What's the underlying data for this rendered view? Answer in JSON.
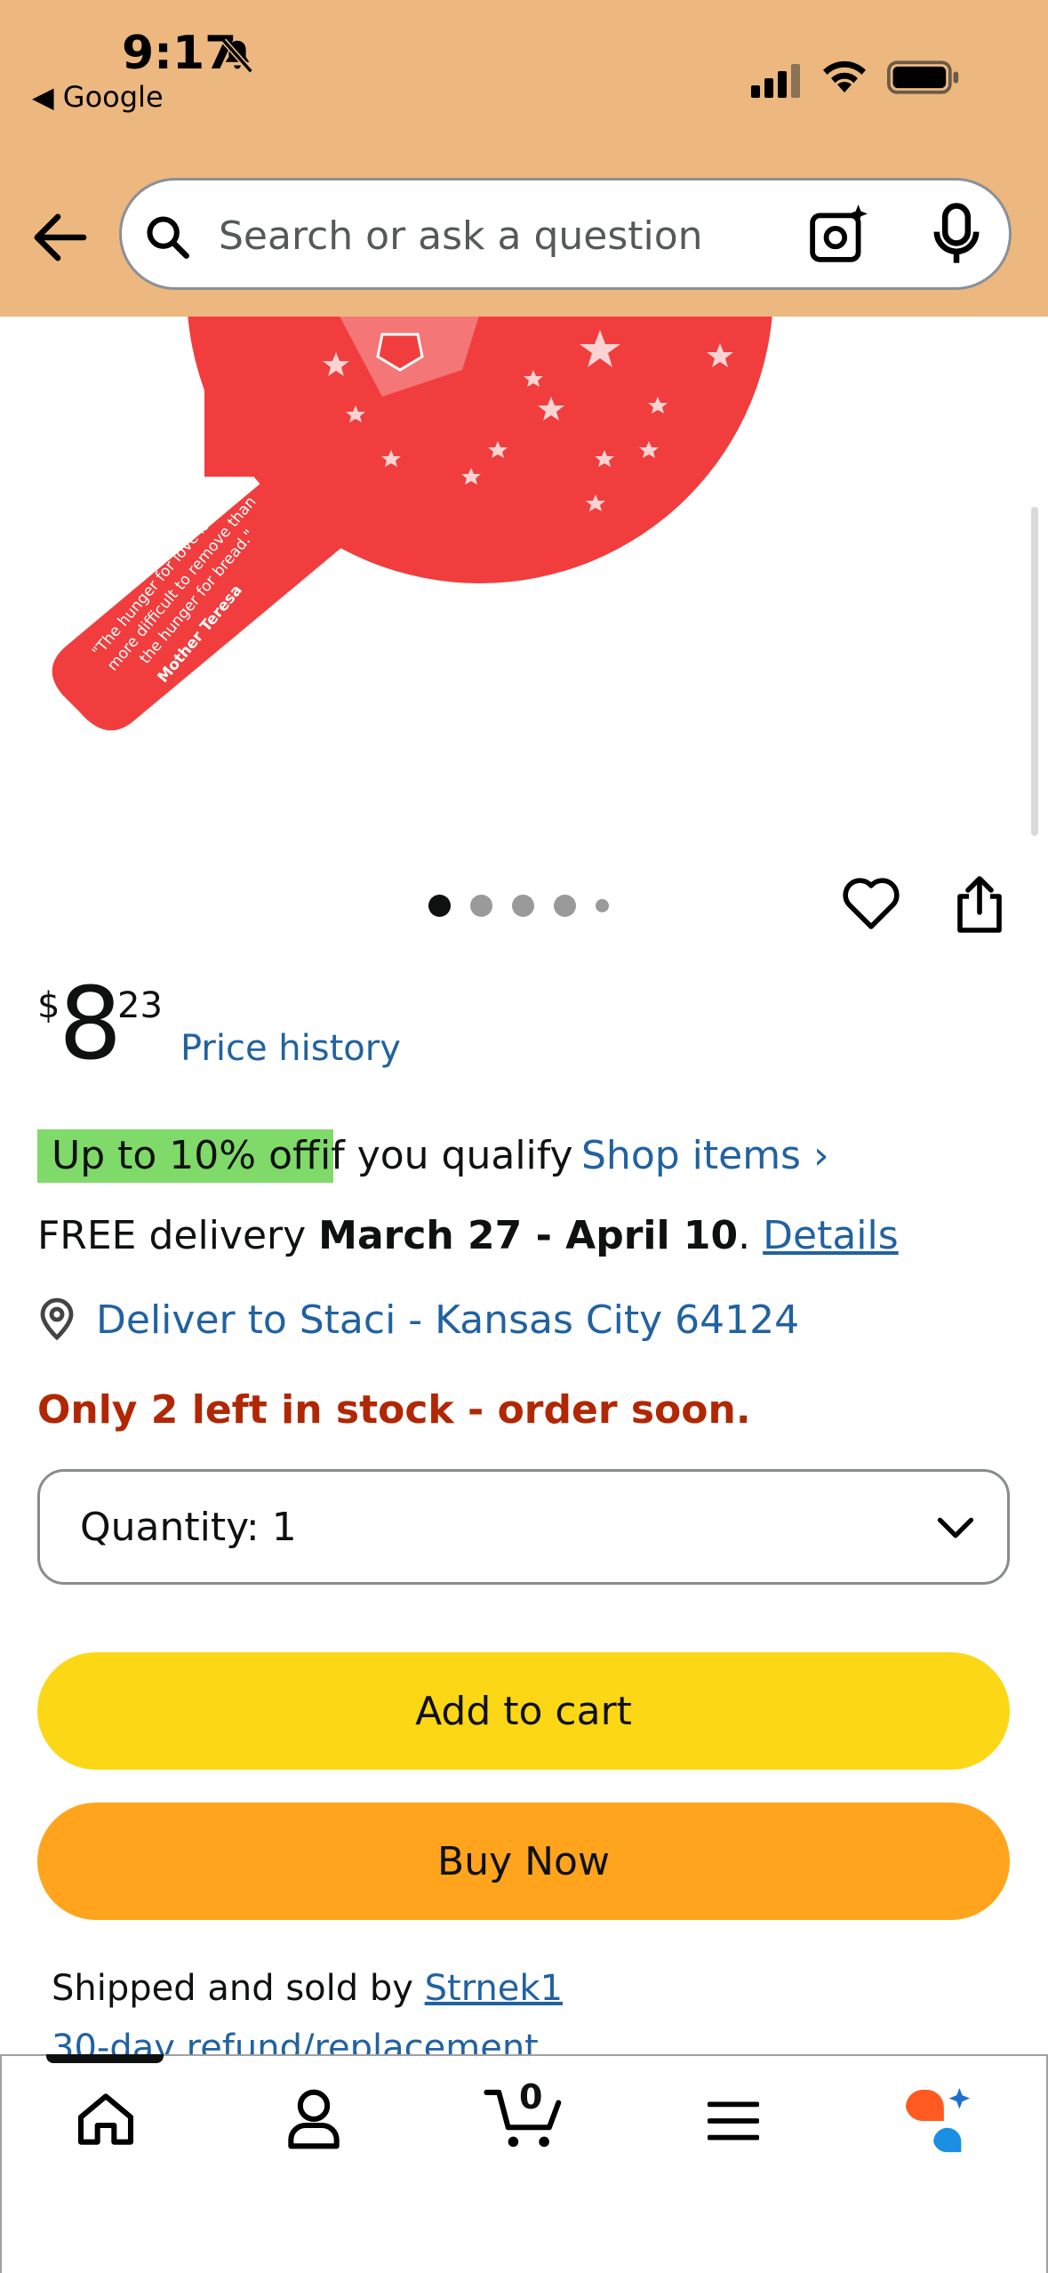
{
  "status_bar": {
    "time": "9:17",
    "back_app": "◀ Google"
  },
  "search": {
    "placeholder": "Search or ask a question"
  },
  "product_image": {
    "quote_line1": "\"The hunger for love is much",
    "quote_line2": "more difficult to remove than",
    "quote_line3": "the hunger for bread.\"",
    "quote_author": "Mother Teresa",
    "image_count": 5,
    "active_index": 0
  },
  "price": {
    "symbol": "$",
    "whole": "8",
    "fraction": "23",
    "history_label": "Price history"
  },
  "discount": {
    "badge": "Up to 10% off",
    "qualify_text": "if you qualify",
    "shop_link": "Shop items ›"
  },
  "delivery": {
    "prefix": "FREE delivery ",
    "dates": "March 27 - April 10",
    "separator": ". ",
    "details_link": "Details"
  },
  "location": {
    "deliver_to": "Deliver to Staci - Kansas City 64124"
  },
  "stock": {
    "message": "Only 2 left in stock - order soon."
  },
  "quantity": {
    "label": "Quantity:",
    "value": "1"
  },
  "buttons": {
    "add_to_cart": "Add to cart",
    "buy_now": "Buy Now"
  },
  "seller": {
    "prefix": "Shipped and sold by ",
    "name": "Strnek1",
    "refund": "30-day refund/replacement"
  },
  "bottom_nav": {
    "cart_count": "0",
    "items": [
      "home-icon",
      "account-icon",
      "cart-icon",
      "menu-icon",
      "rufus-icon"
    ]
  },
  "colors": {
    "header_bg": "#ecb87f",
    "link": "#2162a1",
    "badge_bg": "#7fda69",
    "stock_red": "#b12704",
    "add_to_cart": "#fcd715",
    "buy_now": "#ffa41c",
    "product_red": "#f13d3d"
  }
}
